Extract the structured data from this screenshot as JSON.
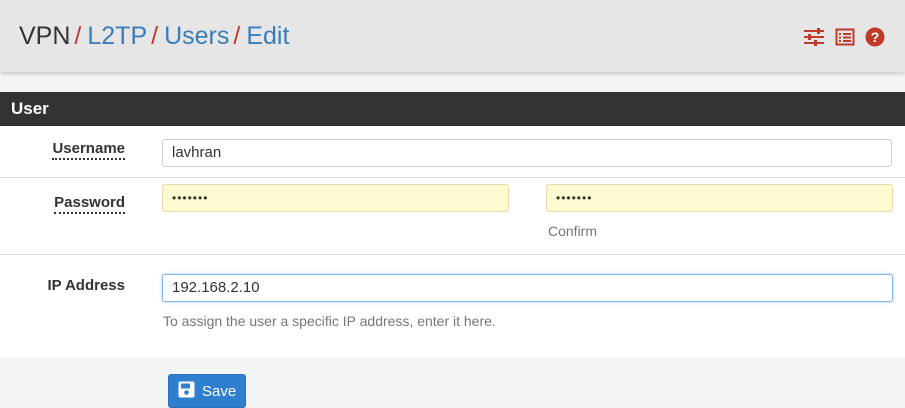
{
  "breadcrumb": {
    "items": [
      "VPN",
      "L2TP",
      "Users",
      "Edit"
    ],
    "separator": "/"
  },
  "header_icons": [
    "sliders-icon",
    "list-icon",
    "help-icon"
  ],
  "panel": {
    "title": "User",
    "fields": {
      "username": {
        "label": "Username",
        "value": "lavhran"
      },
      "password": {
        "label": "Password",
        "value": "•••••••",
        "confirm_value": "•••••••",
        "confirm_help": "Confirm"
      },
      "ip": {
        "label": "IP Address",
        "value": "192.168.2.10",
        "help": "To assign the user a specific IP address, enter it here."
      }
    }
  },
  "save_button": {
    "label": "Save"
  },
  "colors": {
    "accent": "#2f7fd0",
    "link": "#3a7dbb",
    "separator": "#c0392b",
    "panel_header": "#333333"
  }
}
